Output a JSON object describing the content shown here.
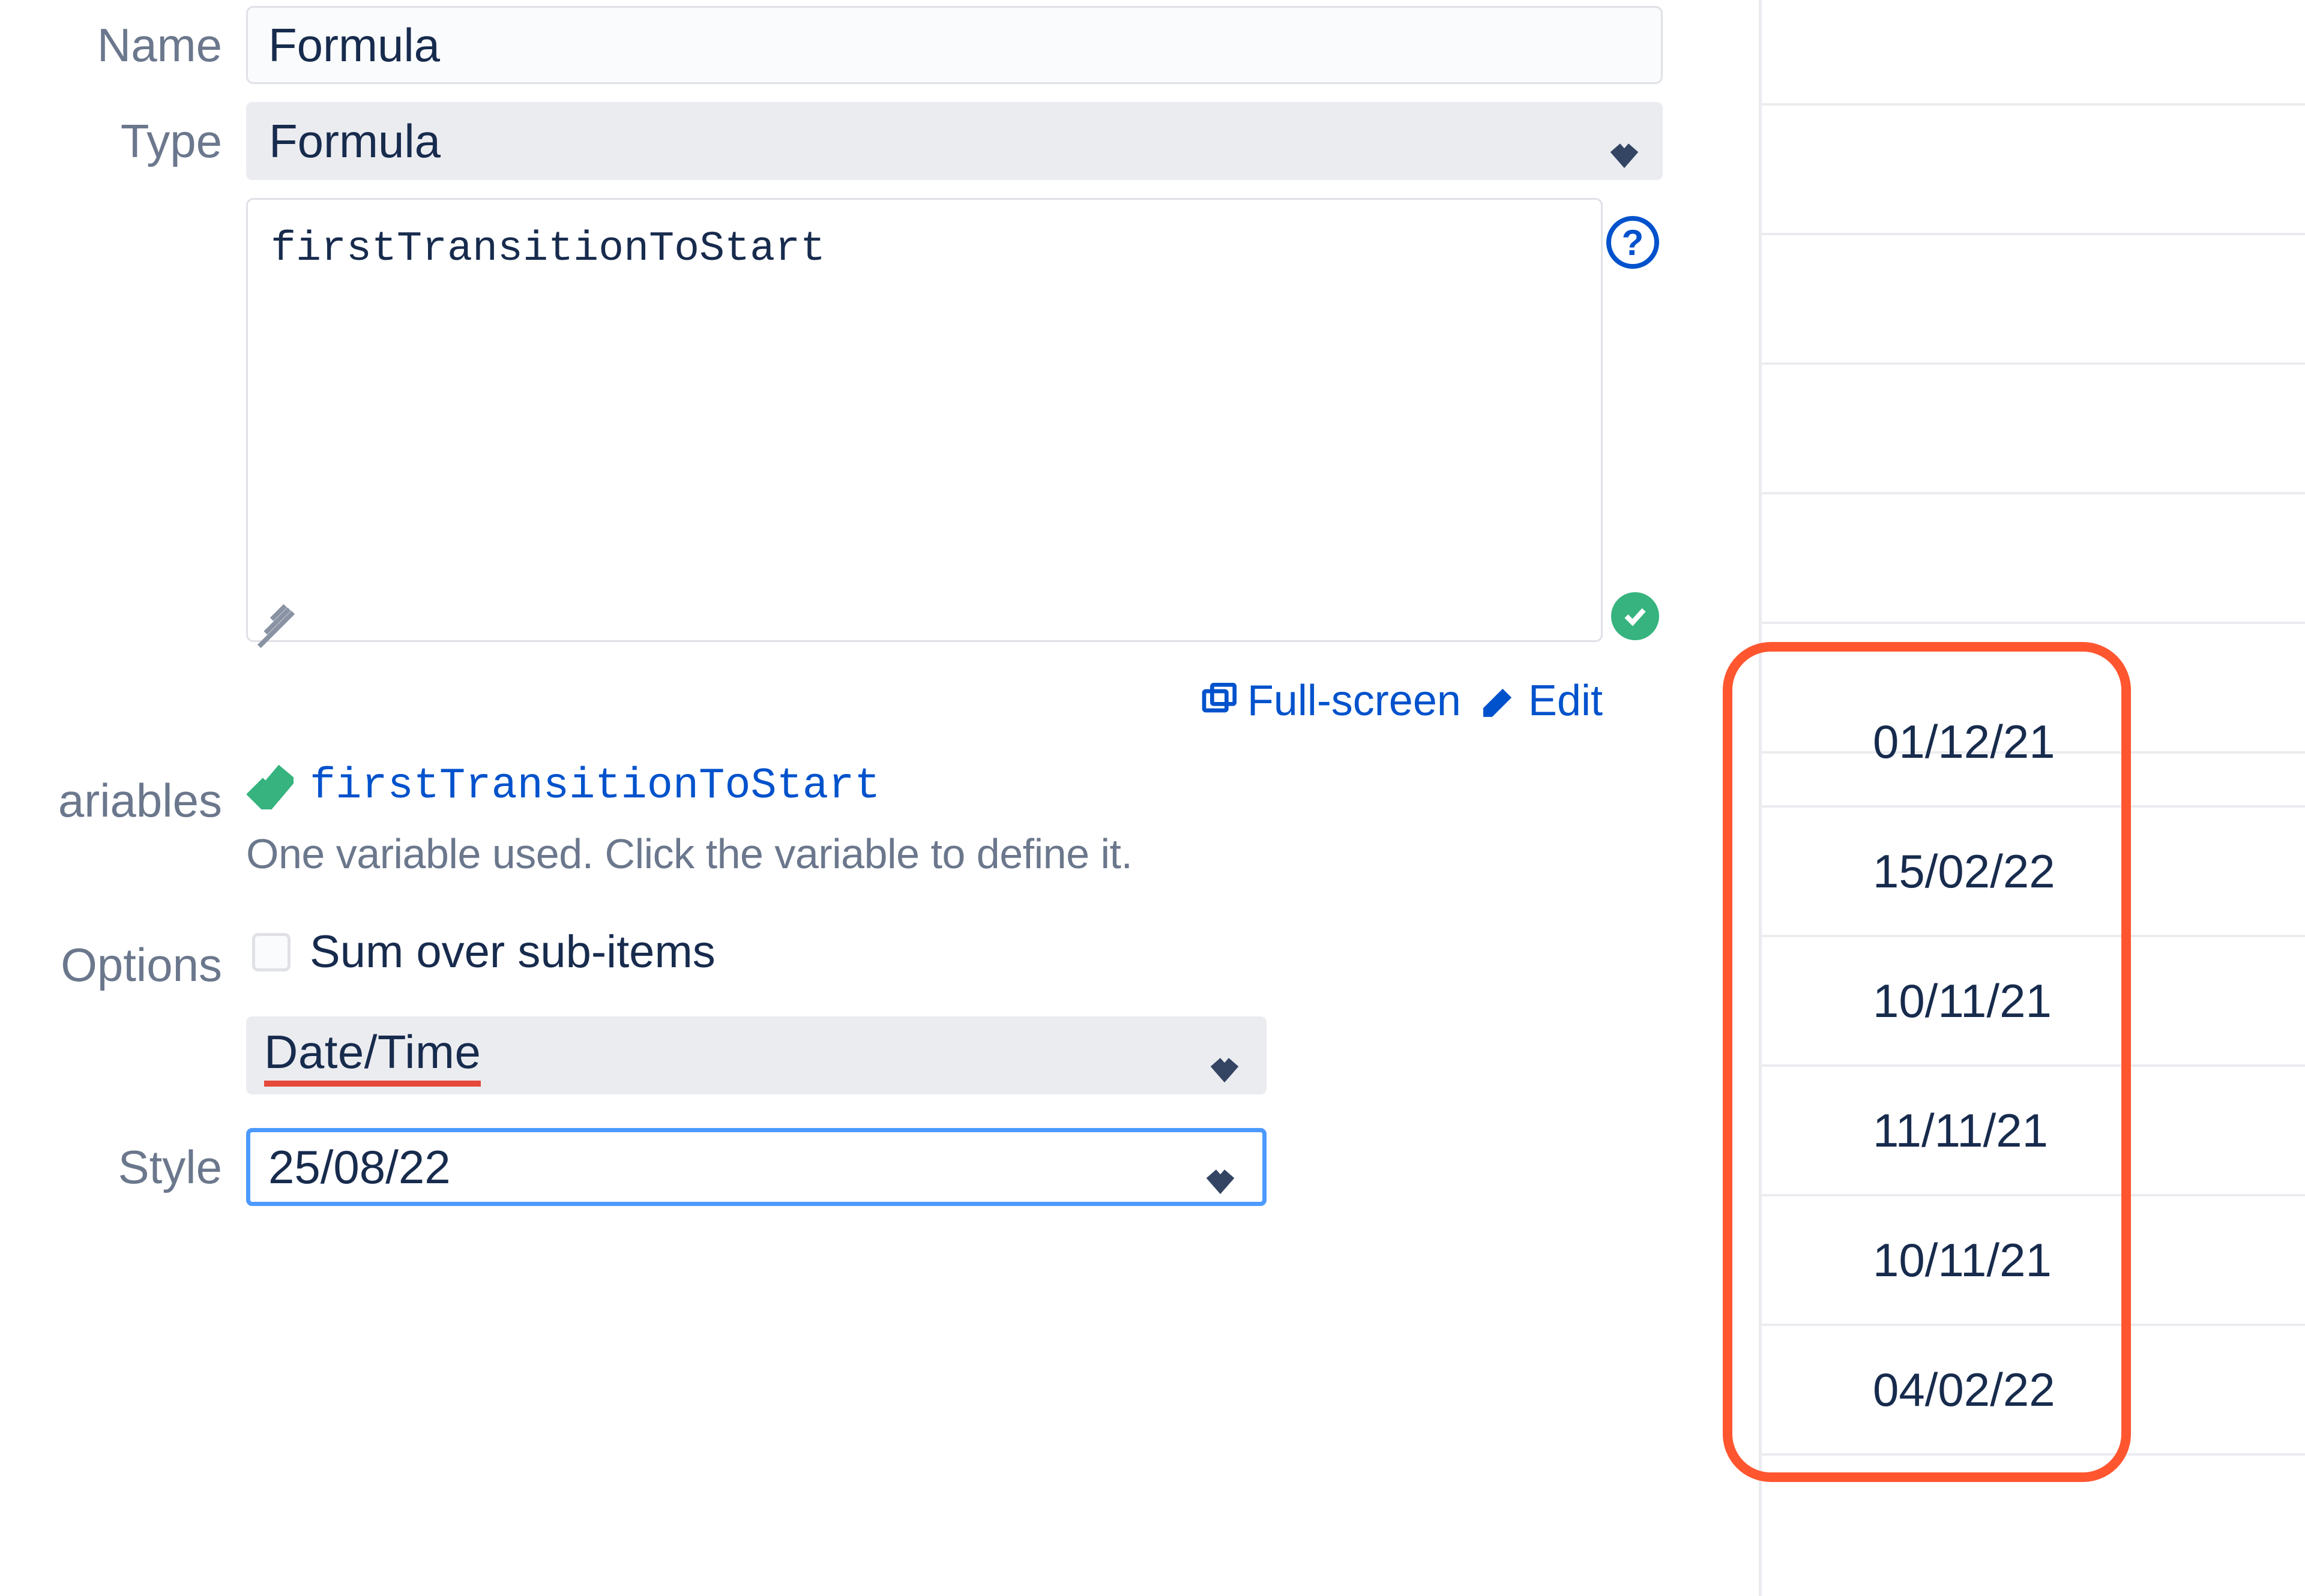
{
  "labels": {
    "name": "Name",
    "type": "Type",
    "variables": "ariables",
    "options": "Options",
    "style": "Style"
  },
  "fields": {
    "name_value": "Formula",
    "type_value": "Formula",
    "code": "firstTransitionToStart",
    "fullscreen": "Full-screen",
    "edit": "Edit",
    "variable_name": "firstTransitionToStart",
    "variable_helper": "One variable used. Click the variable to define it.",
    "sum_label": "Sum over sub-items",
    "format_value": "Date/Time",
    "style_value": "25/08/22"
  },
  "results": [
    "01/12/21",
    "15/02/22",
    "10/11/21",
    "11/11/21",
    "10/11/21",
    "04/02/22"
  ]
}
